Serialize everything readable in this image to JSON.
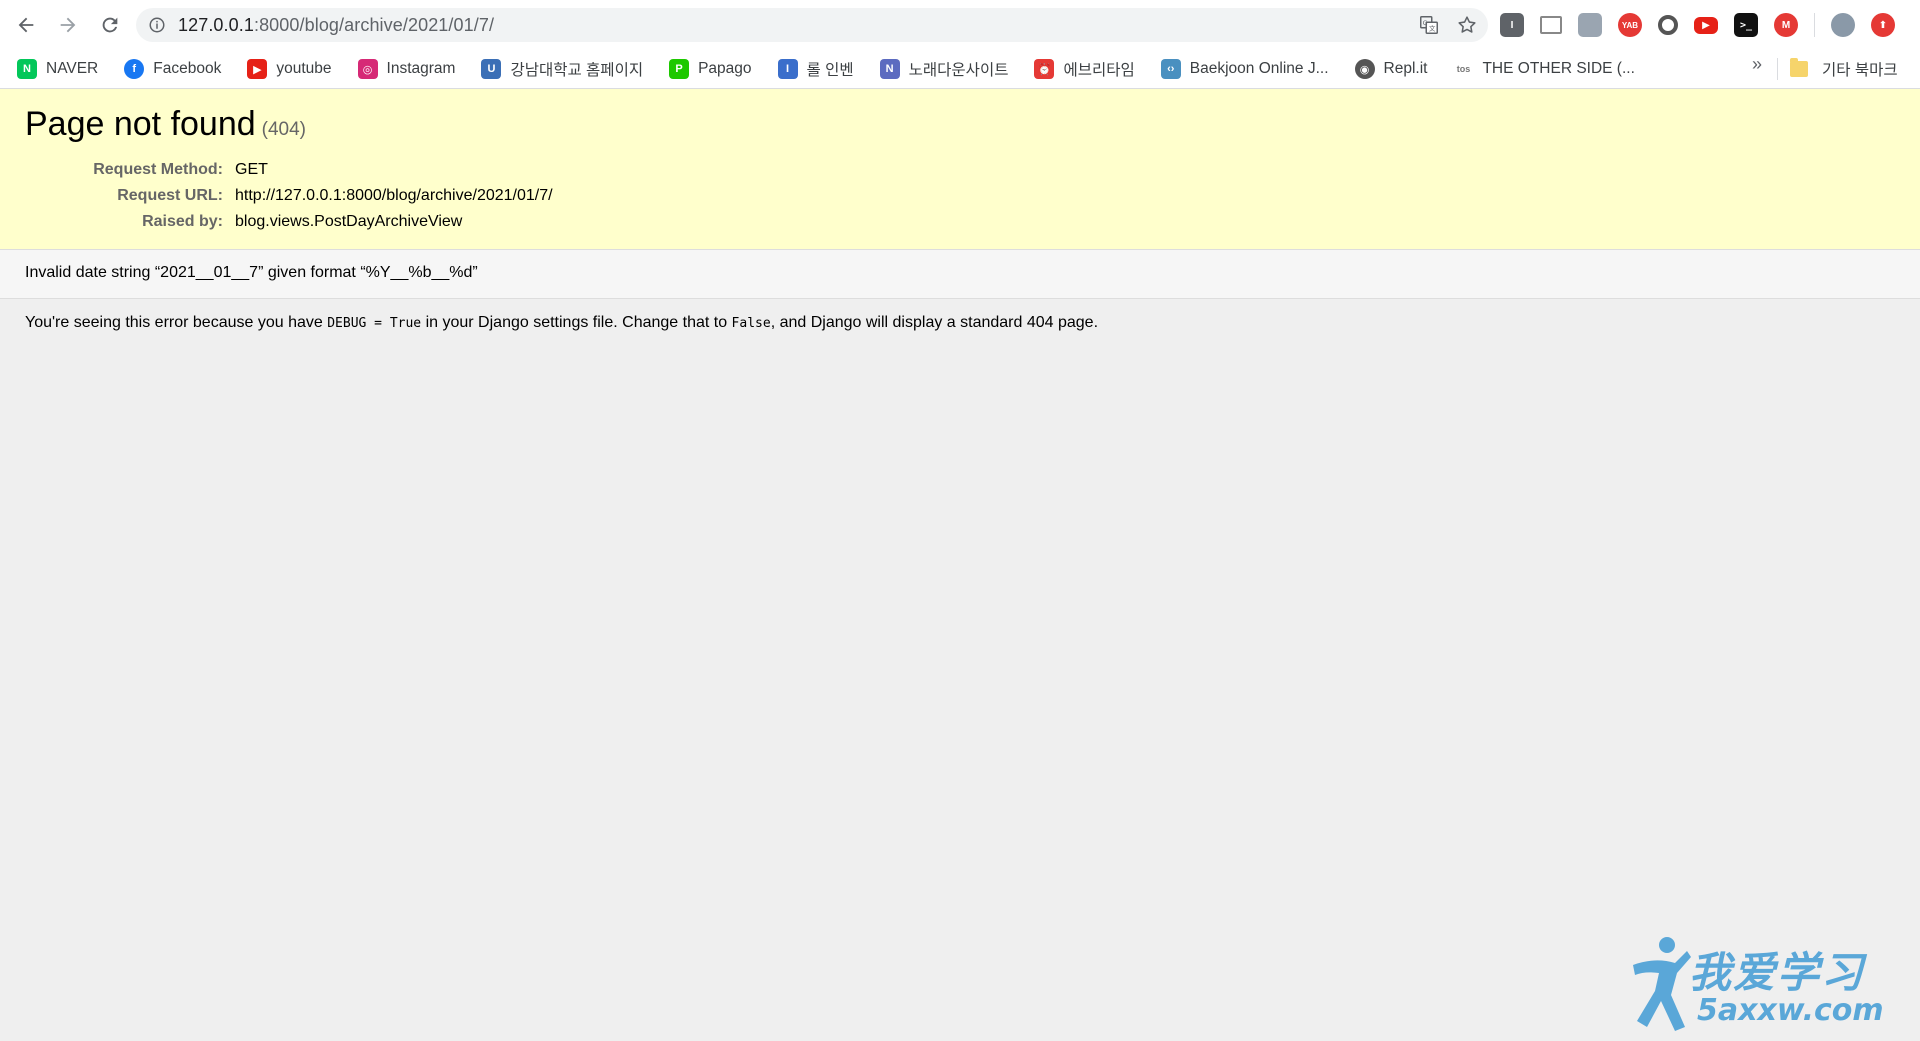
{
  "browser": {
    "url_host": "127.0.0.1",
    "url_path": ":8000/blog/archive/2021/01/7/"
  },
  "bookmarks": [
    {
      "label": "NAVER",
      "icon": "naver-icon",
      "color": "#03c75a"
    },
    {
      "label": "Facebook",
      "icon": "facebook-icon",
      "color": "#1877f2"
    },
    {
      "label": "youtube",
      "icon": "youtube-icon",
      "color": "#e62117"
    },
    {
      "label": "Instagram",
      "icon": "instagram-icon",
      "color": "#d62976"
    },
    {
      "label": "강남대학교 홈페이지",
      "icon": "university-icon",
      "color": "#3b6fb6"
    },
    {
      "label": "Papago",
      "icon": "papago-icon",
      "color": "#1ec800"
    },
    {
      "label": "롤 인벤",
      "icon": "inven-icon",
      "color": "#3a6ecb"
    },
    {
      "label": "노래다운사이트",
      "icon": "music-site-icon",
      "color": "#5c6bc0"
    },
    {
      "label": "에브리타임",
      "icon": "everytime-icon",
      "color": "#e53935"
    },
    {
      "label": "Baekjoon Online J...",
      "icon": "code-icon",
      "color": "#4a90c0"
    },
    {
      "label": "Repl.it",
      "icon": "replit-icon",
      "color": "#555555"
    },
    {
      "label": "THE OTHER SIDE (...",
      "icon": "tos-icon",
      "color": "#777777"
    }
  ],
  "bookmarks_more": "»",
  "bookmarks_folder": "기타 북마크",
  "page": {
    "title": "Page not found",
    "code": "(404)",
    "meta": [
      {
        "key": "Request Method:",
        "value": "GET"
      },
      {
        "key": "Request URL:",
        "value": "http://127.0.0.1:8000/blog/archive/2021/01/7/"
      },
      {
        "key": "Raised by:",
        "value": "blog.views.PostDayArchiveView"
      }
    ],
    "error_message": "Invalid date string “2021__01__7” given format “%Y__%b__%d”",
    "explanation_pre": "You're seeing this error because you have ",
    "explanation_code1": "DEBUG = True",
    "explanation_mid": " in your Django settings file. Change that to ",
    "explanation_code2": "False",
    "explanation_post": ", and Django will display a standard 404 page."
  },
  "watermark": {
    "text": "我爱学习",
    "sub": "5axxw.com"
  }
}
